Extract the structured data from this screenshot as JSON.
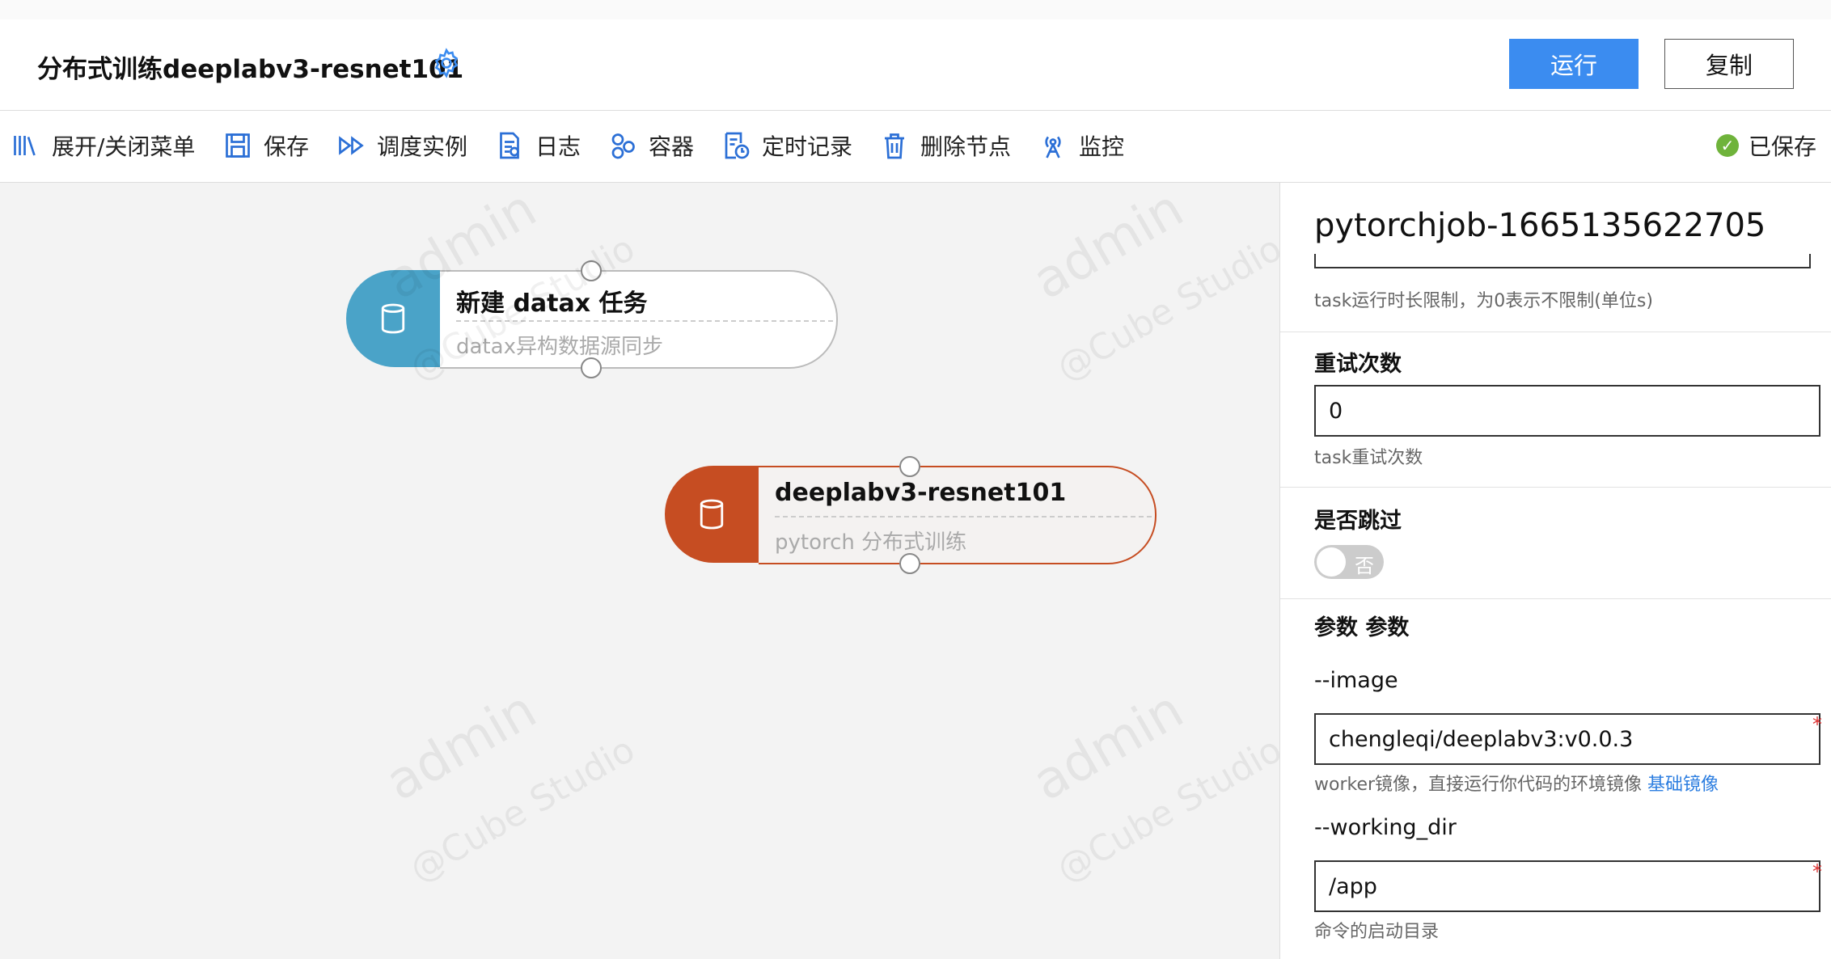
{
  "header": {
    "title": "分布式训练deeplabv3-resnet101",
    "run_label": "运行",
    "copy_label": "复制"
  },
  "toolbar": {
    "items": [
      {
        "label": "展开/关闭菜单",
        "icon": "menu-books-icon"
      },
      {
        "label": "保存",
        "icon": "save-icon"
      },
      {
        "label": "调度实例",
        "icon": "forward-icon"
      },
      {
        "label": "日志",
        "icon": "log-icon"
      },
      {
        "label": "容器",
        "icon": "container-icon"
      },
      {
        "label": "定时记录",
        "icon": "timer-record-icon"
      },
      {
        "label": "删除节点",
        "icon": "trash-icon"
      },
      {
        "label": "监控",
        "icon": "antenna-icon"
      }
    ],
    "saved_label": "已保存"
  },
  "canvas": {
    "nodes": [
      {
        "title": "新建 datax 任务",
        "subtitle": "datax异构数据源同步",
        "color": "#4aa3c8"
      },
      {
        "title": "deeplabv3-resnet101",
        "subtitle": "pytorch 分布式训练",
        "color": "#c64d22"
      }
    ]
  },
  "panel": {
    "title": "pytorchjob-1665135622705",
    "timeout_hint": "task运行时长限制，为0表示不限制(单位s)",
    "retry": {
      "label": "重试次数",
      "value": "0",
      "hint": "task重试次数"
    },
    "skip": {
      "label": "是否跳过",
      "toggle_label": "否"
    },
    "params_heading": "参数 参数",
    "image": {
      "label": "--image",
      "value": "chengleqi/deeplabv3:v0.0.3",
      "hint": "worker镜像，直接运行你代码的环境镜像",
      "link": "基础镜像"
    },
    "working_dir": {
      "label": "--working_dir",
      "value": "/app",
      "hint": "命令的启动目录"
    },
    "required_mark": "*"
  },
  "watermark": {
    "line1": "admin",
    "line2": "@Cube Studio"
  }
}
